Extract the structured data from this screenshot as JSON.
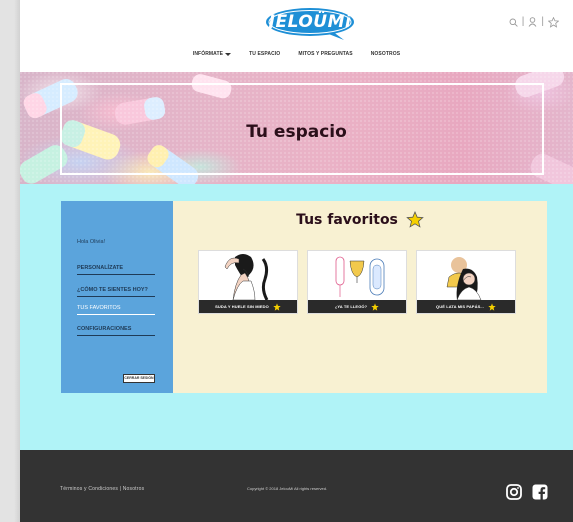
{
  "header": {
    "logo_text": "JELOÜMi",
    "icons": [
      "search-icon",
      "user-icon",
      "star-icon"
    ],
    "separators": [
      "|",
      "|"
    ]
  },
  "nav": {
    "items": [
      {
        "label": "INFÓRMATE",
        "has_dropdown": true
      },
      {
        "label": "TU ESPACIO"
      },
      {
        "label": "MITOS Y PREGUNTAS"
      },
      {
        "label": "NOSOTROS"
      }
    ]
  },
  "hero": {
    "title": "Tu espacio"
  },
  "sidebar": {
    "greeting": "Hola Olivia!",
    "items": [
      {
        "label": "PERSONALÍZATE"
      },
      {
        "label": "¿CÓMO TE SIENTES HOY?"
      },
      {
        "label": "TUS FAVORITOS",
        "active": true
      },
      {
        "label": "CONFIGURACIONES"
      }
    ],
    "logout_label": "CERRAR SESIÓN"
  },
  "favorites": {
    "title": "Tus favoritos",
    "cards": [
      {
        "label": "SUDA Y HUELE SIN MIEDO",
        "icon": "woman-armpit-illustration"
      },
      {
        "label": "¿YA TE LLEGÓ?",
        "icon": "period-products-illustration"
      },
      {
        "label": "QUÉ LATA MIS PAPÁS...",
        "icon": "embarrassed-girl-illustration"
      }
    ]
  },
  "footer": {
    "links": "Términos y Condiciones  |  Nosotros",
    "copyright": "Copyright © 2018 JelouMi All rights reserved.",
    "social": [
      "instagram-icon",
      "facebook-icon"
    ]
  },
  "colors": {
    "logo_blue": "#1e8fd6",
    "content_bg": "#b0f3f7",
    "panel_bg": "#f8f1d2",
    "sidebar_bg": "#5ba4dc",
    "footer_bg": "#333333",
    "star_yellow": "#f5d000"
  }
}
